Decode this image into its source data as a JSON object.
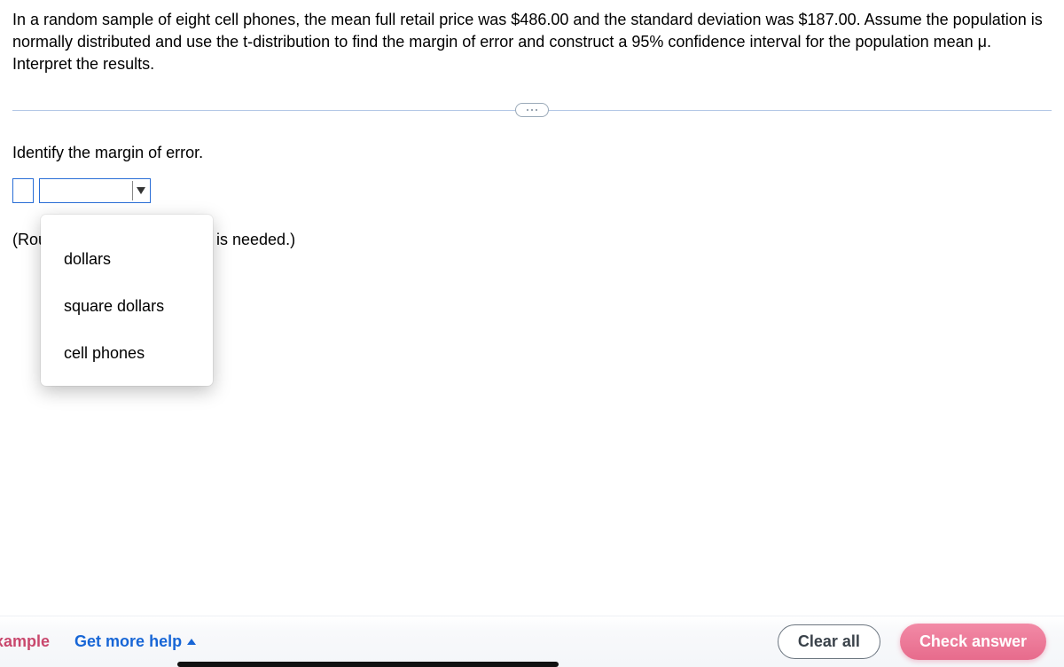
{
  "problem": "In a random sample of eight cell phones, the mean full retail price was $486.00 and the standard deviation was $187.00. Assume the population is normally distributed and use the t-distribution to find the margin of error and construct a 95% confidence interval for the population mean μ. Interpret the results.",
  "question": {
    "prompt": "Identify the margin of error.",
    "hint_left": "(Rou",
    "hint_right": "is needed.)"
  },
  "dropdown": {
    "options": [
      "dollars",
      "square dollars",
      "cell phones"
    ]
  },
  "footer": {
    "example": "xample",
    "more_help": "Get more help",
    "clear": "Clear all",
    "check": "Check answer"
  }
}
